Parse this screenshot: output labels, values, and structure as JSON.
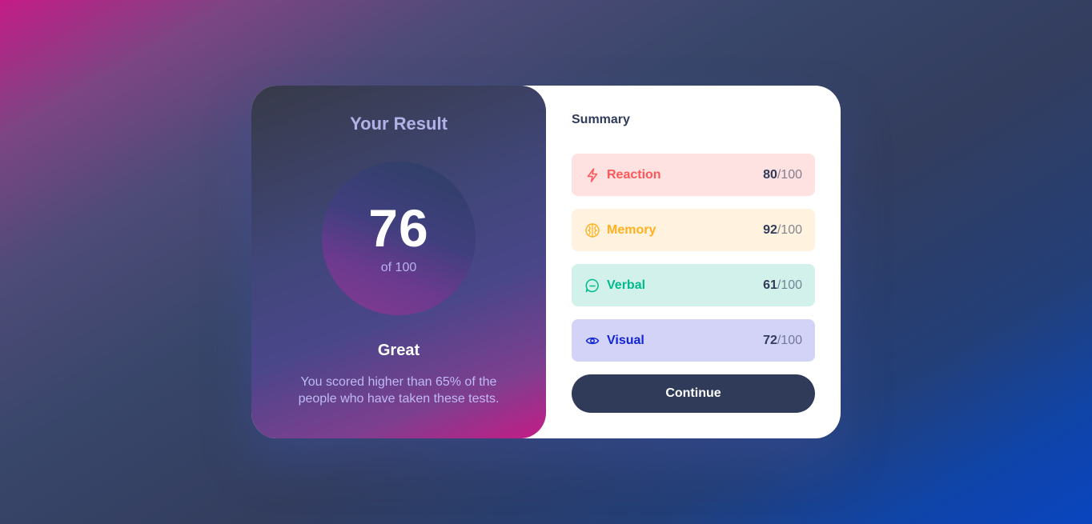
{
  "result": {
    "title": "Your Result",
    "score": "76",
    "score_max": "of 100",
    "rating": "Great",
    "description": "You scored higher than 65% of the people who have taken these tests."
  },
  "summary": {
    "title": "Summary",
    "items": [
      {
        "label": "Reaction",
        "score": "80",
        "max": "/100",
        "icon": "lightning-icon",
        "color": "#ff5757",
        "bg": "#fee1e1"
      },
      {
        "label": "Memory",
        "score": "92",
        "max": "/100",
        "icon": "brain-icon",
        "color": "#ffb01f",
        "bg": "#fff3df"
      },
      {
        "label": "Verbal",
        "score": "61",
        "max": "/100",
        "icon": "chat-bubble-icon",
        "color": "#00bb8f",
        "bg": "#d1f1ea"
      },
      {
        "label": "Visual",
        "score": "72",
        "max": "/100",
        "icon": "eye-icon",
        "color": "#1125d6",
        "bg": "#d3d3f7"
      }
    ],
    "continue_label": "Continue"
  },
  "colors": {
    "dark_navy": "#303b5a",
    "gradient_pink": "#c41c86",
    "gradient_blue": "#0a45c0"
  }
}
